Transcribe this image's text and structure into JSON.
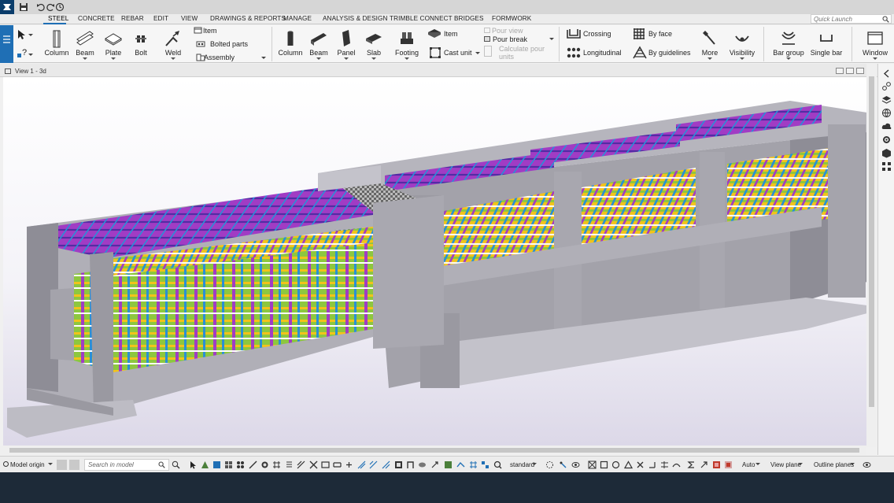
{
  "colors": {
    "brand": "#1f6fb5",
    "status_bar": "#1d2a38",
    "model_concrete": "#9b9aa3",
    "model_steel_magenta": "#a13cc4",
    "model_green": "#8dc73f",
    "model_yellow": "#f2c31a",
    "model_blue": "#2a8fd6"
  },
  "titlebar": {
    "icons": [
      "app-logo-icon",
      "save-icon",
      "undo-icon",
      "redo-icon",
      "history-icon"
    ]
  },
  "menu": {
    "tabs": [
      "STEEL",
      "CONCRETE",
      "REBAR",
      "EDIT",
      "VIEW",
      "DRAWINGS & REPORTS",
      "MANAGE",
      "ANALYSIS & DESIGN",
      "TRIMBLE CONNECT",
      "BRIDGES",
      "FORMWORK"
    ],
    "active": "STEEL",
    "quick_launch_placeholder": "Quick Launch"
  },
  "ribbon": {
    "steel": {
      "column": "Column",
      "beam": "Beam",
      "plate": "Plate",
      "bolt": "Bolt",
      "weld": "Weld",
      "item": "Item",
      "bolted_parts": "Bolted parts",
      "assembly": "Assembly"
    },
    "concrete": {
      "column": "Column",
      "beam": "Beam",
      "panel": "Panel",
      "slab": "Slab",
      "footing": "Footing",
      "item": "Item",
      "cast_unit": "Cast unit",
      "pour_view": "Pour view",
      "pour_break": "Pour break",
      "calculate_pour_units": "Calculate pour units"
    },
    "rebar": {
      "crossing": "Crossing",
      "longitudinal": "Longitudinal",
      "by_face": "By face",
      "by_guidelines": "By guidelines",
      "more": "More",
      "visibility": "Visibility",
      "bar_group": "Bar group",
      "single_bar": "Single bar"
    },
    "window": "Window"
  },
  "view": {
    "title": "View 1 - 3d"
  },
  "bottom": {
    "model_origin": "Model origin",
    "search_placeholder": "Search in model",
    "standard": "standard",
    "auto": "Auto",
    "view_plane": "View plane",
    "outline_planes": "Outline planes"
  }
}
